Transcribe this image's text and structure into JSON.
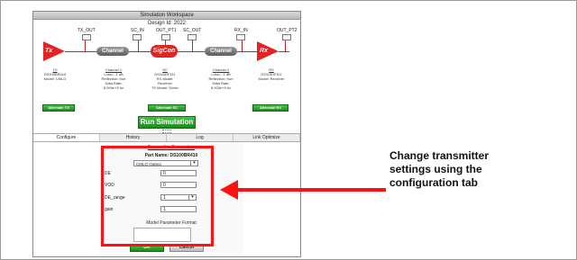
{
  "window": {
    "title": "Simulation Workspace",
    "design_id": "Design Id: 2022"
  },
  "schematic": {
    "ports": [
      "TX_OUT",
      "SC_IN",
      "OUT_PT1",
      "SC_OUT",
      "RX_IN",
      "OUT_PT2"
    ],
    "blocks": {
      "tx": {
        "label": "Tx",
        "info": [
          "TX",
          "DS100BR410",
          "Model: CMLO"
        ]
      },
      "channel1": {
        "label": "Channel",
        "info": [
          "Channel 1",
          "Loss= -1 dB",
          "Reflection: true",
          "Data Rate:",
          "5.000e+9 hz"
        ]
      },
      "sigcon": {
        "label": "SigCon",
        "info": [
          "SC",
          "DS110DF111",
          "RX Model:",
          "Receiver",
          "TX Model: Driver"
        ]
      },
      "channel2": {
        "label": "Channel",
        "info": [
          "Channel 2",
          "Loss= -1 dB",
          "Reflection: true",
          "Data Rate:",
          "5.000e+9 hz"
        ]
      },
      "rx": {
        "label": "Rx",
        "info": [
          "RX",
          "DS110DF111",
          "Model: Receiver"
        ]
      }
    },
    "alternate_buttons": [
      "Alternate TX",
      "Alternate SC",
      "Alternate RX"
    ],
    "run_button": "Run Simulation"
  },
  "tabs": [
    {
      "label": "Configure",
      "active": true
    },
    {
      "label": "History",
      "active": false
    },
    {
      "label": "Log",
      "active": false
    },
    {
      "label": "Link Optimize",
      "active": false
    }
  ],
  "panel": {
    "title": "Transmitter Parameters",
    "part_name": "Part Name: DS100BR410",
    "model_select": "CMLO   Output",
    "fields": [
      {
        "label": "DE",
        "value": "0"
      },
      {
        "label": "VOD",
        "value": "0"
      },
      {
        "label": "DE_range",
        "value": "1"
      },
      {
        "label": "gain",
        "value": "1"
      }
    ],
    "model_parameter_heading": "Model Parameter Format",
    "ok_label": "OK",
    "cancel_label": "Cancel"
  },
  "callout": {
    "text": "Change transmitter settings using the configuration tab"
  },
  "colors": {
    "accent_red": "#e02424",
    "button_green": "#1e8c1e",
    "highlight_red": "#ff1111"
  }
}
